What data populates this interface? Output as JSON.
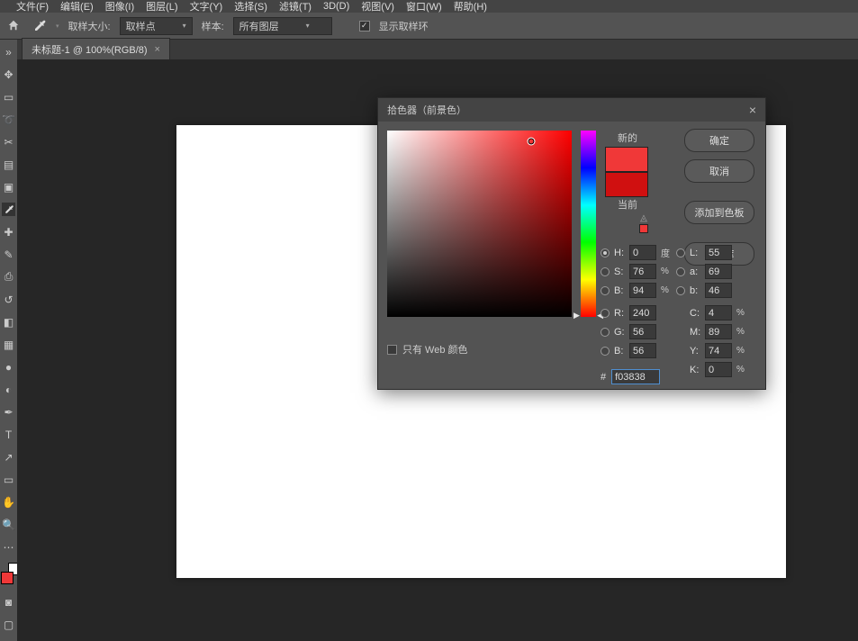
{
  "menu": {
    "items": [
      "文件(F)",
      "编辑(E)",
      "图像(I)",
      "图层(L)",
      "文字(Y)",
      "选择(S)",
      "滤镜(T)",
      "3D(D)",
      "视图(V)",
      "窗口(W)",
      "帮助(H)"
    ]
  },
  "options": {
    "sample_size_label": "取样大小:",
    "sample_size_value": "取样点",
    "sample_label": "样本:",
    "sample_value": "所有图层",
    "show_ring": "显示取样环"
  },
  "tab": {
    "title": "未标题-1 @ 100%(RGB/8)"
  },
  "picker": {
    "title": "拾色器（前景色）",
    "buttons": {
      "ok": "确定",
      "cancel": "取消",
      "add": "添加到色板",
      "lib": "颜色库"
    },
    "new_label": "新的",
    "current_label": "当前",
    "web_only": "只有 Web 颜色",
    "H": "0",
    "S": "76",
    "B2": "94",
    "L": "55",
    "a": "69",
    "b_lab": "46",
    "R": "240",
    "G": "56",
    "B": "56",
    "C": "4",
    "M": "89",
    "Y": "74",
    "K": "0",
    "hex": "f03838",
    "deg": "度",
    "pct": "%",
    "lbl": {
      "H": "H:",
      "S": "S:",
      "Bv": "B:",
      "L": "L:",
      "a": "a:",
      "b": "b:",
      "R": "R:",
      "G": "G:",
      "B": "B:",
      "C": "C:",
      "M": "M:",
      "Y": "Y:",
      "K": "K:",
      "hash": "#"
    }
  },
  "tools": [
    "↕",
    "▭",
    "⊹",
    "✂",
    "▤",
    "✎",
    "✦",
    "⊘",
    "↻",
    "✎",
    "⌫",
    "◧",
    "▲",
    "◌",
    "◐",
    "●",
    "◆",
    "⬚",
    "…",
    "T",
    "⬜",
    "✋",
    "⊕"
  ]
}
